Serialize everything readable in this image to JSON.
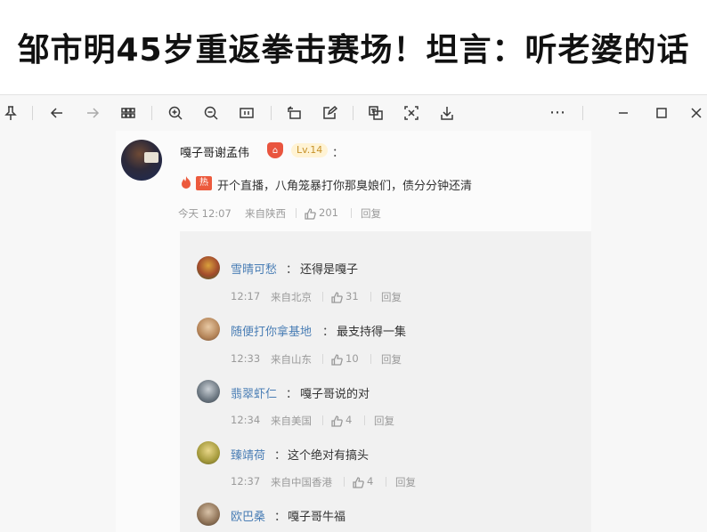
{
  "headline": "邹市明45岁重返拳击赛场！坦言：听老婆的话",
  "toolbar": {
    "icons": [
      "pin-icon",
      "back-arrow-icon",
      "forward-arrow-icon",
      "grid-icon",
      "zoom-in-icon",
      "zoom-out-icon",
      "fit-page-icon",
      "rotate-icon",
      "edit-icon",
      "translate-icon",
      "crop-icon",
      "download-icon",
      "more-icon",
      "minimize-icon",
      "maximize-icon",
      "close-icon"
    ]
  },
  "main_comment": {
    "username": "嘎子哥谢孟伟",
    "level": "Lv.14",
    "colon": "：",
    "hot_tag": "热",
    "text": "开个直播，八角笼暴打你那臭娘们，债分分钟还清",
    "time": "今天 12:07",
    "location": "来自陕西",
    "likes": "201",
    "reply": "回复"
  },
  "replies": [
    {
      "name": "雪晴可愁",
      "colon": "：",
      "text": "还得是嘎子",
      "time": "12:17",
      "location": "来自北京",
      "likes": "31",
      "reply": "回复"
    },
    {
      "name": "随便打你拿基地",
      "colon": "：",
      "text": "最支持得一集",
      "time": "12:33",
      "location": "来自山东",
      "likes": "10",
      "reply": "回复"
    },
    {
      "name": "翡翠虾仁",
      "colon": "：",
      "text": "嘎子哥说的对",
      "time": "12:34",
      "location": "来自美国",
      "likes": "4",
      "reply": "回复"
    },
    {
      "name": "臻靖荷",
      "colon": "：",
      "text": "这个绝对有搞头",
      "time": "12:37",
      "location": "来自中国香港",
      "likes": "4",
      "reply": "回复"
    },
    {
      "name": "欧巴桑",
      "colon": "：",
      "text": "嘎子哥牛福"
    }
  ]
}
